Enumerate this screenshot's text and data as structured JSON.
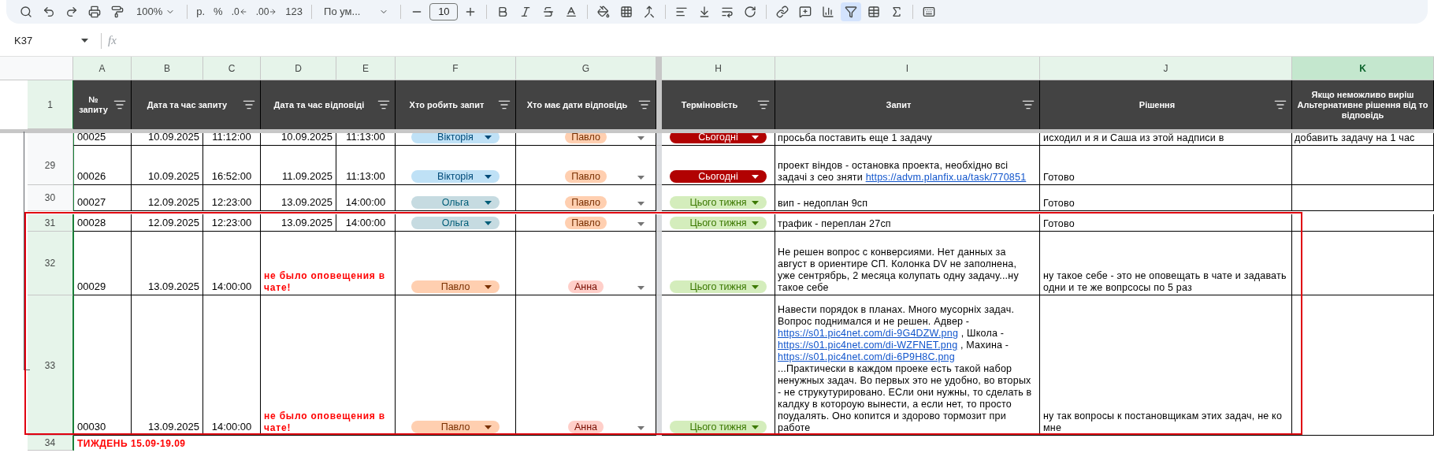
{
  "toolbar": {
    "zoom": "100%",
    "currency": "р.",
    "percent": "%",
    "decimal_decrease": ".0",
    "decimal_increase": ".00",
    "number_format": "123",
    "font": "По ум...",
    "font_size": "10",
    "filter_selected": true
  },
  "formula_bar": {
    "cell_ref": "K37",
    "fx": "fx"
  },
  "columns": [
    {
      "letter": "A",
      "selected": false
    },
    {
      "letter": "B",
      "selected": false
    },
    {
      "letter": "C",
      "selected": false
    },
    {
      "letter": "D",
      "selected": false
    },
    {
      "letter": "E",
      "selected": false
    },
    {
      "letter": "F",
      "selected": false
    },
    {
      "letter": "G",
      "selected": false
    },
    {
      "letter": "H",
      "selected": false
    },
    {
      "letter": "I",
      "selected": false
    },
    {
      "letter": "J",
      "selected": false
    },
    {
      "letter": "K",
      "selected": true
    }
  ],
  "header_row": {
    "number": "1",
    "selected": true,
    "headers": [
      {
        "lines": [
          "№",
          "запиту"
        ],
        "filter": true
      },
      {
        "lines": [
          "Дата та час запиту"
        ],
        "filter": true
      },
      {
        "lines": [
          "Дата та час відповіді"
        ],
        "filter": true
      },
      {
        "lines": [
          "Хто робить запит"
        ],
        "filter": true
      },
      {
        "lines": [
          "Хто має дати відповідь"
        ],
        "filter": true
      },
      {
        "lines": [
          "Терміновість"
        ],
        "filter": true
      },
      {
        "lines": [
          "Запит"
        ],
        "filter": true
      },
      {
        "lines": [
          "Рішення"
        ],
        "filter": true
      },
      {
        "lines": [
          "Якщо неможливо виріш",
          "Альтернативне рішення від то",
          "відповідь"
        ],
        "filter": false
      }
    ]
  },
  "rows": [
    {
      "selected": false,
      "number_no": "00025",
      "req_date": "10.09.2025",
      "req_time": "11:12:00",
      "resp_date": "10.09.2025",
      "resp_time": "11:13:00",
      "requester": {
        "name": "Вікторія",
        "color": "#bfe1f6"
      },
      "responder": {
        "name": "Павло",
        "color": "#ffcfb0"
      },
      "urgency": {
        "label": "Сьогодні",
        "color": "#b10202"
      },
      "request": [
        {
          "kind": "text",
          "text": "просьба поставить еще 1 задачу"
        }
      ],
      "solution": "исходил и я и Саша из этой надписи в",
      "alternative": "добавить задачу на 1 час"
    },
    {
      "number": "29",
      "selected": false,
      "number_no": "00026",
      "req_date": "10.09.2025",
      "req_time": "16:52:00",
      "resp_date": "11.09.2025",
      "resp_time": "11:13:00",
      "requester": {
        "name": "Вікторія",
        "color": "#bfe1f6"
      },
      "responder": {
        "name": "Павло",
        "color": "#ffcfb0"
      },
      "urgency": {
        "label": "Сьогодні",
        "color": "#b10202"
      },
      "request": [
        {
          "kind": "text",
          "text": "проект віндов - остановка проекта, необхідно всі задачі з сео зняти "
        },
        {
          "kind": "link",
          "text": "https://advm.planfix.ua/task/770851"
        }
      ],
      "solution": "Готово"
    },
    {
      "number": "30",
      "selected": false,
      "number_no": "00027",
      "req_date": "12.09.2025",
      "req_time": "12:23:00",
      "resp_date": "13.09.2025",
      "resp_time": "14:00:00",
      "requester": {
        "name": "Ольга",
        "color": "#c6dbe1"
      },
      "responder": {
        "name": "Павло",
        "color": "#ffcfb0"
      },
      "urgency": {
        "label": "Цього тижня",
        "color": "#d4edbc"
      },
      "request": [
        {
          "kind": "text",
          "text": "вип - недоплан 9сп"
        }
      ],
      "solution": "Готово"
    },
    {
      "number": "31",
      "selected": true,
      "number_no": "00028",
      "req_date": "12.09.2025",
      "req_time": "12:23:00",
      "resp_date": "13.09.2025",
      "resp_time": "14:00:00",
      "requester": {
        "name": "Ольга",
        "color": "#c6dbe1"
      },
      "responder": {
        "name": "Павло",
        "color": "#ffcfb0"
      },
      "urgency": {
        "label": "Цього тижня",
        "color": "#d4edbc"
      },
      "request": [
        {
          "kind": "text",
          "text": "трафик - переплан 27сп"
        }
      ],
      "solution": "Готово"
    },
    {
      "number": "32",
      "selected": true,
      "number_no": "00029",
      "req_date": "13.09.2025",
      "req_time": "14:00:00",
      "note": "не было оповещения в чате!",
      "requester": {
        "name": "Павло",
        "color": "#ffcfb0"
      },
      "responder": {
        "name": "Анна",
        "color": "#ffcfc9"
      },
      "urgency": {
        "label": "Цього тижня",
        "color": "#d4edbc"
      },
      "request": [
        {
          "kind": "text",
          "text": "Не решен вопрос с конверсиями. Нет данных за август в ориентире СП. Колонка DV не заполнена, уже сентрябрь, 2 месяца колупать одну задачу...ну такое себе"
        }
      ],
      "solution": "ну такое себе - это не оповещать в чате и задавать одни и те же вопрсосы по 5 раз"
    },
    {
      "number": "33",
      "selected": true,
      "number_no": "00030",
      "req_date": "13.09.2025",
      "req_time": "14:00:00",
      "note": "не было оповещения в чате!",
      "requester": {
        "name": "Павло",
        "color": "#ffcfb0"
      },
      "responder": {
        "name": "Анна",
        "color": "#ffcfc9"
      },
      "urgency": {
        "label": "Цього тижня",
        "color": "#d4edbc"
      },
      "request": [
        {
          "kind": "text",
          "text": "Навести порядок в планах. Много мусорніх задач. Вопрос поднимался и не решен. Адвер - "
        },
        {
          "kind": "link",
          "text": "https://s01.pic4net.com/di-9G4DZW.png"
        },
        {
          "kind": "text",
          "text": " , Школа - "
        },
        {
          "kind": "link",
          "text": "https://s01.pic4net.com/di-WZFNET.png"
        },
        {
          "kind": "text",
          "text": " , Махина - "
        },
        {
          "kind": "link",
          "text": "https://s01.pic4net.com/di-6P9H8C.png"
        },
        {
          "kind": "text",
          "text": "\n...Практически в каждом проеке есть такой набор ненужных задач. Во первых это не удобно, во вторых - не струкутурировано. ЕСли они нужны, то сделать в калдку в котороую вынести, а если нет, то просто поудалять. Оно копится и здорово тормозит при работе"
        }
      ],
      "solution": "ну так вопросы к постановщикам этих задач, не ко мне"
    }
  ],
  "week_row": {
    "number": "34",
    "selected": true,
    "label": "ТИЖДЕНЬ 15.09-19.09"
  }
}
